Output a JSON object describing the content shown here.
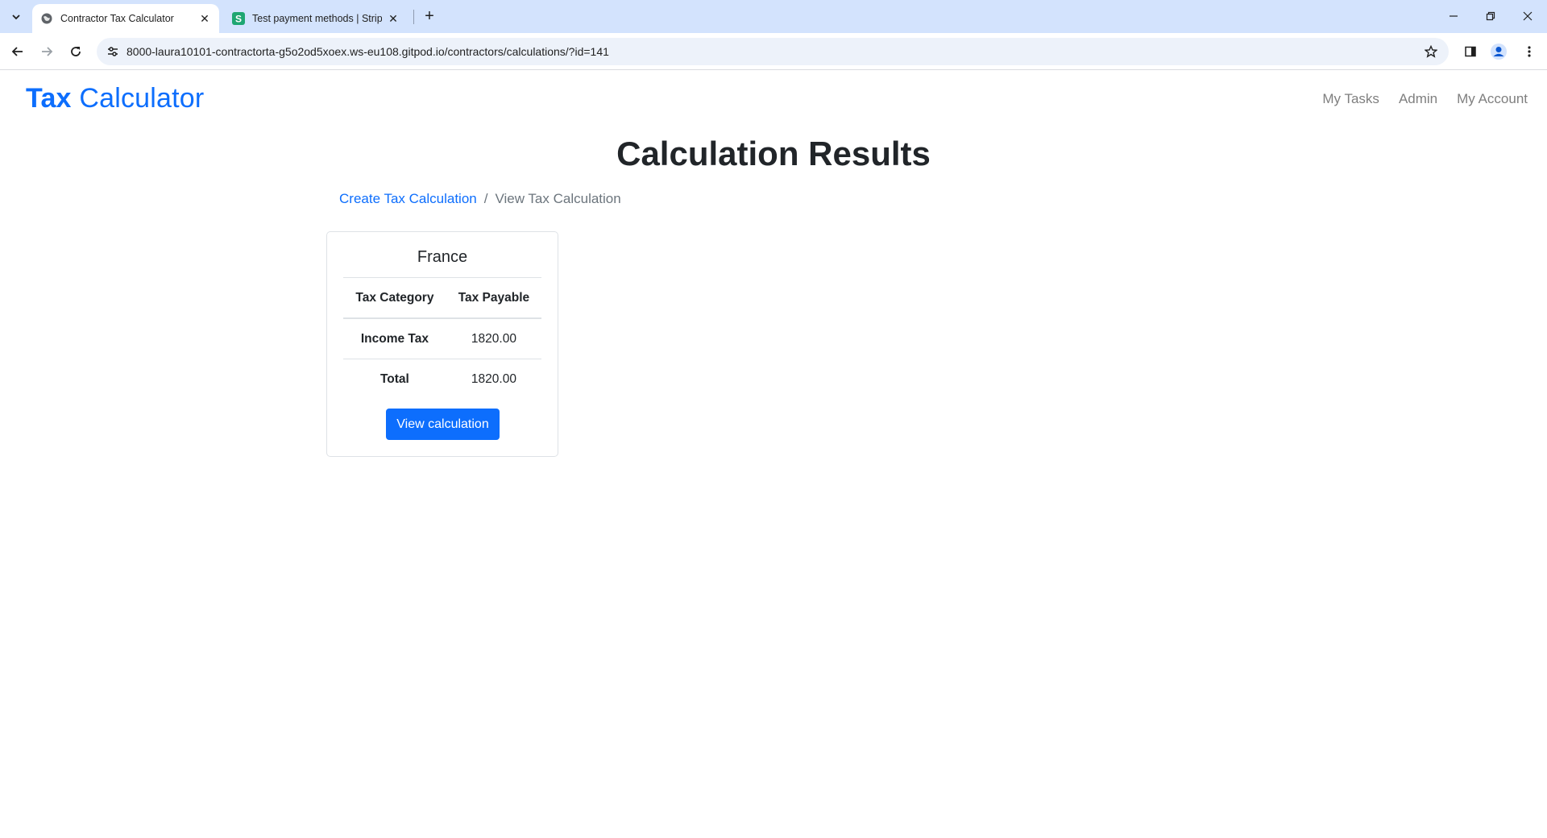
{
  "browser": {
    "tabs": [
      {
        "title": "Contractor Tax Calculator",
        "active": true,
        "favicon": "globe-icon"
      },
      {
        "title": "Test payment methods | Stripe Documentation",
        "active": false,
        "favicon": "stripe-s-icon"
      }
    ],
    "url": "8000-laura10101-contractorta-g5o2od5xoex.ws-eu108.gitpod.io/contractors/calculations/?id=141",
    "colors": {
      "tab_strip": "#d3e3fd",
      "omnibox": "#edf2fa",
      "stripe_green": "#1ea672"
    }
  },
  "navbar": {
    "brand_bold": "Tax",
    "brand_rest": "Calculator",
    "links": [
      "My Tasks",
      "Admin",
      "My Account"
    ]
  },
  "main": {
    "title": "Calculation Results",
    "breadcrumb": {
      "link": "Create Tax Calculation",
      "separator": "/",
      "current": "View Tax Calculation"
    },
    "card": {
      "country": "France",
      "headers": [
        "Tax Category",
        "Tax Payable"
      ],
      "rows": [
        {
          "category": "Income Tax",
          "payable": "1820.00"
        },
        {
          "category": "Total",
          "payable": "1820.00"
        }
      ],
      "button_label": "View calculation"
    }
  },
  "colors": {
    "primary": "#0d6efd",
    "text": "#212529",
    "muted": "#6c757d",
    "nav_link": "#7f7f7f"
  }
}
